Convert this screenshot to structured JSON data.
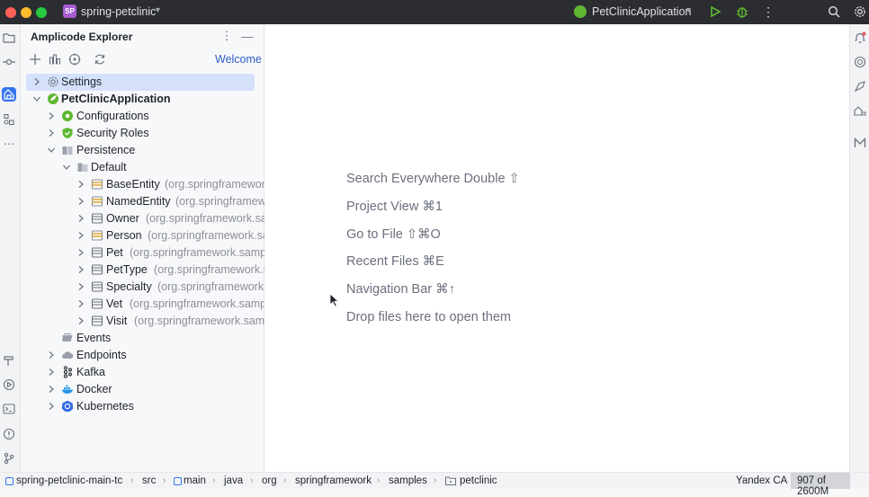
{
  "titlebar": {
    "project_badge": "SP",
    "project_name": "spring-petclinic",
    "run_config": "PetClinicApplication",
    "colors": {
      "close": "#ff5f57",
      "minimize": "#febc2e",
      "maximize": "#28c840"
    }
  },
  "panel": {
    "title": "Amplicode Explorer",
    "welcome_link": "Welcome",
    "tree": [
      {
        "label": "Settings",
        "icon": "gear-icon"
      },
      {
        "label": "PetClinicApplication",
        "icon": "spring-app-icon"
      },
      {
        "label": "Configurations",
        "icon": "configurations-icon"
      },
      {
        "label": "Security Roles",
        "icon": "shield-icon"
      },
      {
        "label": "Persistence",
        "icon": "persistence-icon"
      },
      {
        "label": "Default",
        "icon": "folder-icon"
      },
      {
        "label": "BaseEntity",
        "pkg": "(org.springframework",
        "icon": "mapped-superclass-icon"
      },
      {
        "label": "NamedEntity",
        "pkg": "(org.springframew",
        "icon": "mapped-superclass-icon"
      },
      {
        "label": "Owner",
        "pkg": "(org.springframework.sa",
        "icon": "entity-icon"
      },
      {
        "label": "Person",
        "pkg": "(org.springframework.sa",
        "icon": "mapped-superclass-icon"
      },
      {
        "label": "Pet",
        "pkg": "(org.springframework.sampl",
        "icon": "entity-icon"
      },
      {
        "label": "PetType",
        "pkg": "(org.springframework.s",
        "icon": "entity-icon"
      },
      {
        "label": "Specialty",
        "pkg": "(org.springframework.",
        "icon": "entity-icon"
      },
      {
        "label": "Vet",
        "pkg": "(org.springframework.sampl",
        "icon": "entity-icon"
      },
      {
        "label": "Visit",
        "pkg": "(org.springframework.samp",
        "icon": "entity-icon"
      },
      {
        "label": "Events",
        "icon": "events-icon"
      },
      {
        "label": "Endpoints",
        "icon": "cloud-icon"
      },
      {
        "label": "Kafka",
        "icon": "kafka-icon"
      },
      {
        "label": "Docker",
        "icon": "docker-icon"
      },
      {
        "label": "Kubernetes",
        "icon": "kubernetes-icon"
      }
    ]
  },
  "editor": {
    "hints": [
      "Search Everywhere Double ⇧",
      "Project View ⌘1",
      "Go to File ⇧⌘O",
      "Recent Files ⌘E",
      "Navigation Bar ⌘↑",
      "Drop files here to open them"
    ]
  },
  "statusbar": {
    "breadcrumbs": [
      "spring-petclinic-main-tc",
      "src",
      "main",
      "java",
      "org",
      "springframework",
      "samples",
      "petclinic"
    ],
    "encoding": "Yandex CA",
    "memory": "907 of 2600M"
  }
}
